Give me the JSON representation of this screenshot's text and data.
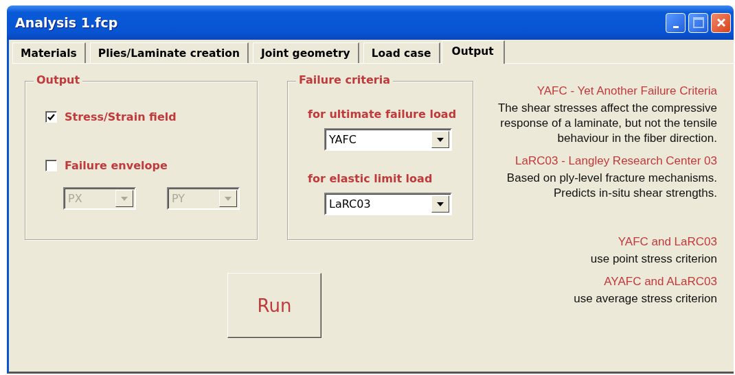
{
  "window": {
    "title": "Analysis 1.fcp",
    "controls": [
      {
        "kind": "minimize"
      },
      {
        "kind": "maximize"
      },
      {
        "kind": "close"
      }
    ]
  },
  "tabs": [
    {
      "label": "Materials",
      "selected": false
    },
    {
      "label": "Plies/Laminate creation",
      "selected": false
    },
    {
      "label": "Joint geometry",
      "selected": false
    },
    {
      "label": "Load case",
      "selected": false
    },
    {
      "label": "Output",
      "selected": true
    }
  ],
  "output_group": {
    "title": "Output",
    "options": [
      {
        "label": "Stress/Strain field",
        "checked": true
      },
      {
        "label": "Failure envelope",
        "checked": false
      }
    ],
    "envelope_axes": [
      {
        "value": "PX",
        "disabled": true
      },
      {
        "value": "PY",
        "disabled": true
      }
    ]
  },
  "criteria_group": {
    "title": "Failure criteria",
    "selectors": [
      {
        "label": "for ultimate failure load",
        "value": "YAFC"
      },
      {
        "label": "for elastic limit load",
        "value": "LaRC03"
      }
    ]
  },
  "run_button": {
    "label": "Run"
  },
  "criteria_notes": [
    {
      "heading": "YAFC - Yet Another Failure Criteria",
      "body": "The shear stresses affect the compressive response of a laminate, but not the tensile behaviour in the fiber direction."
    },
    {
      "heading": "LaRC03 - Langley Research Center 03",
      "body": "Based on ply-level fracture mechanisms. Predicts in-situ shear strengths."
    }
  ],
  "method_notes": [
    {
      "heading": "YAFC and LaRC03",
      "body": "use point stress criterion"
    },
    {
      "heading": "AYAFC and ALaRC03",
      "body": "use average stress criterion"
    }
  ]
}
